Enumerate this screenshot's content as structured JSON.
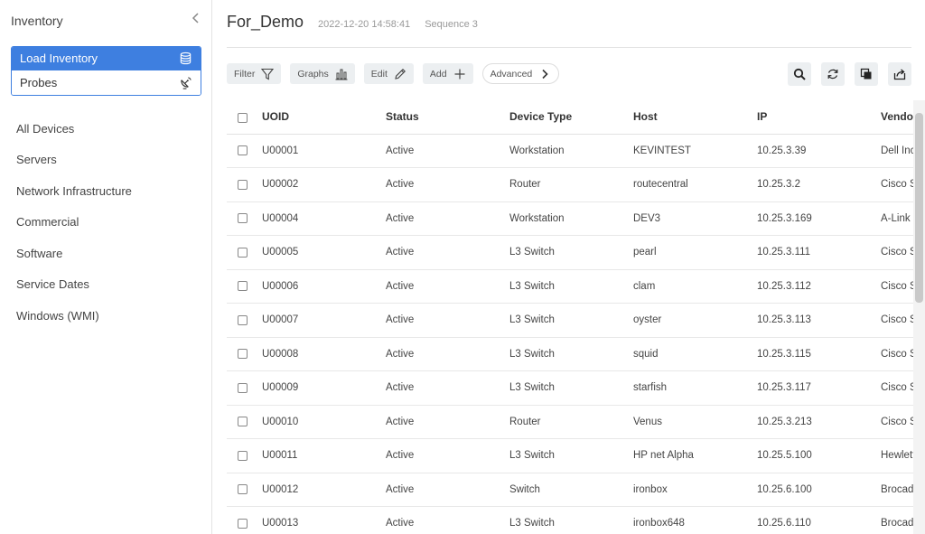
{
  "sidebar": {
    "title": "Inventory",
    "actions": [
      {
        "label": "Load Inventory",
        "icon": "database-icon"
      },
      {
        "label": "Probes",
        "icon": "satellite-dish-icon"
      }
    ],
    "items": [
      {
        "label": "All Devices"
      },
      {
        "label": "Servers"
      },
      {
        "label": "Network Infrastructure"
      },
      {
        "label": "Commercial"
      },
      {
        "label": "Software"
      },
      {
        "label": "Service Dates"
      },
      {
        "label": "Windows (WMI)"
      }
    ]
  },
  "header": {
    "title": "For_Demo",
    "timestamp": "2022-12-20 14:58:41",
    "sequence": "Sequence 3"
  },
  "toolbar": {
    "filter_label": "Filter",
    "graphs_label": "Graphs",
    "edit_label": "Edit",
    "add_label": "Add",
    "advanced_label": "Advanced",
    "right_icons": [
      "search-icon",
      "refresh-icon",
      "copy-icon",
      "export-icon"
    ]
  },
  "table": {
    "columns": [
      "UOID",
      "Status",
      "Device Type",
      "Host",
      "IP",
      "Vendor"
    ],
    "rows": [
      {
        "uoid": "U00001",
        "status": "Active",
        "type": "Workstation",
        "host": "KEVINTEST",
        "ip": "10.25.3.39",
        "vendor": "Dell Inc."
      },
      {
        "uoid": "U00002",
        "status": "Active",
        "type": "Router",
        "host": "routecentral",
        "ip": "10.25.3.2",
        "vendor": "Cisco Systems"
      },
      {
        "uoid": "U00004",
        "status": "Active",
        "type": "Workstation",
        "host": "DEV3",
        "ip": "10.25.3.169",
        "vendor": "A-Link"
      },
      {
        "uoid": "U00005",
        "status": "Active",
        "type": "L3 Switch",
        "host": "pearl",
        "ip": "10.25.3.111",
        "vendor": "Cisco Systems"
      },
      {
        "uoid": "U00006",
        "status": "Active",
        "type": "L3 Switch",
        "host": "clam",
        "ip": "10.25.3.112",
        "vendor": "Cisco Systems"
      },
      {
        "uoid": "U00007",
        "status": "Active",
        "type": "L3 Switch",
        "host": "oyster",
        "ip": "10.25.3.113",
        "vendor": "Cisco Systems"
      },
      {
        "uoid": "U00008",
        "status": "Active",
        "type": "L3 Switch",
        "host": "squid",
        "ip": "10.25.3.115",
        "vendor": "Cisco Systems"
      },
      {
        "uoid": "U00009",
        "status": "Active",
        "type": "L3 Switch",
        "host": "starfish",
        "ip": "10.25.3.117",
        "vendor": "Cisco Systems"
      },
      {
        "uoid": "U00010",
        "status": "Active",
        "type": "Router",
        "host": "Venus",
        "ip": "10.25.3.213",
        "vendor": "Cisco Systems"
      },
      {
        "uoid": "U00011",
        "status": "Active",
        "type": "L3 Switch",
        "host": "HP net Alpha",
        "ip": "10.25.5.100",
        "vendor": "Hewlett-Packard"
      },
      {
        "uoid": "U00012",
        "status": "Active",
        "type": "Switch",
        "host": "ironbox",
        "ip": "10.25.6.100",
        "vendor": "Brocade"
      },
      {
        "uoid": "U00013",
        "status": "Active",
        "type": "L3 Switch",
        "host": "ironbox648",
        "ip": "10.25.6.110",
        "vendor": "Brocade"
      }
    ]
  },
  "colors": {
    "accent": "#3e7fe0",
    "button_bg": "#eceff1",
    "border": "#e2e2e2"
  }
}
